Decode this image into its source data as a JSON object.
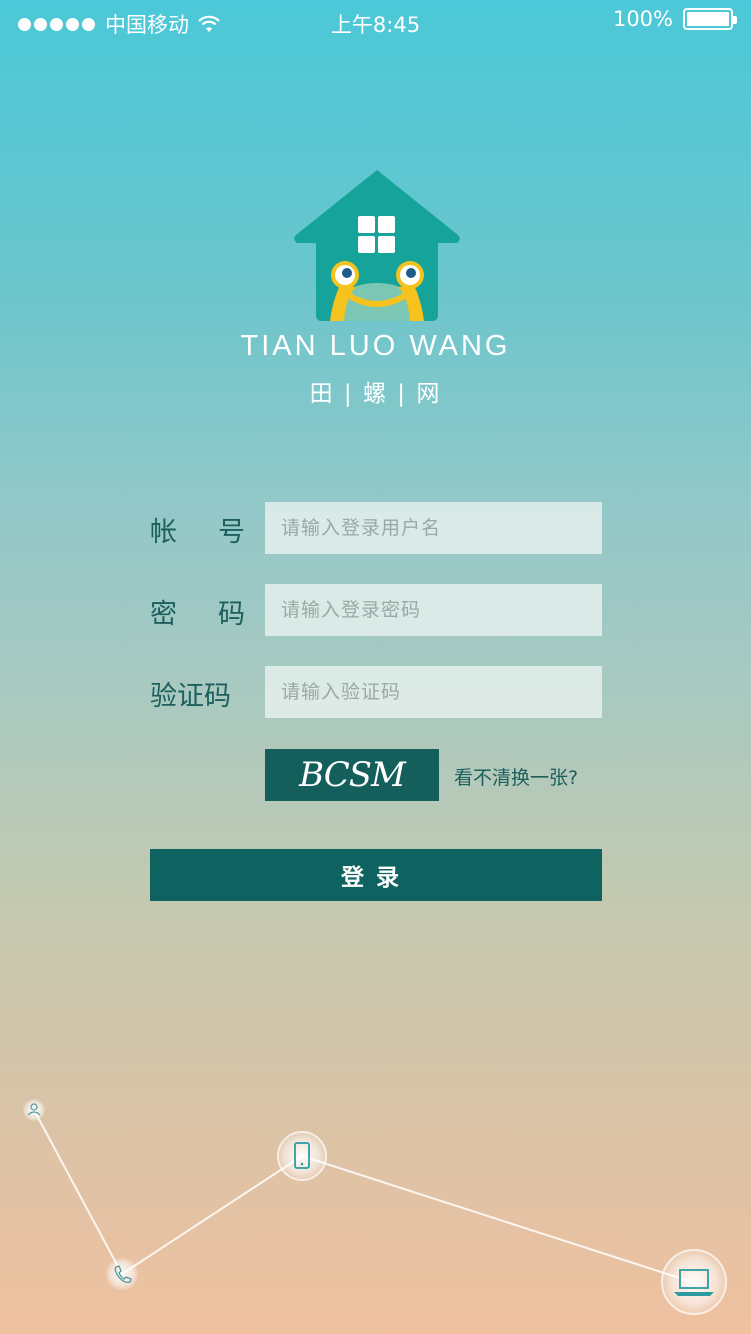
{
  "status_bar": {
    "carrier": "中国移动",
    "time": "上午8:45",
    "battery": "100%",
    "battery_level": 1.0
  },
  "brand": {
    "english_name": "TIAN LUO WANG",
    "chinese_name": "田 | 螺 | 网"
  },
  "form": {
    "account": {
      "label_chars": [
        "帐",
        "号"
      ],
      "placeholder": "请输入登录用户名",
      "value": ""
    },
    "password": {
      "label_chars": [
        "密",
        "码"
      ],
      "placeholder": "请输入登录密码",
      "value": ""
    },
    "captcha": {
      "label_chars": [
        "验证码"
      ],
      "placeholder": "请输入验证码",
      "value": ""
    },
    "captcha_image_text": "BCSM",
    "refresh_label": "看不清换一张?",
    "login_label": "登录"
  },
  "colors": {
    "accent": "#0e6360",
    "label": "#1d5f5d",
    "logo_house": "#16a39a"
  },
  "decoration_icons": [
    "user-icon",
    "phone-icon",
    "mobile-icon",
    "laptop-icon"
  ]
}
